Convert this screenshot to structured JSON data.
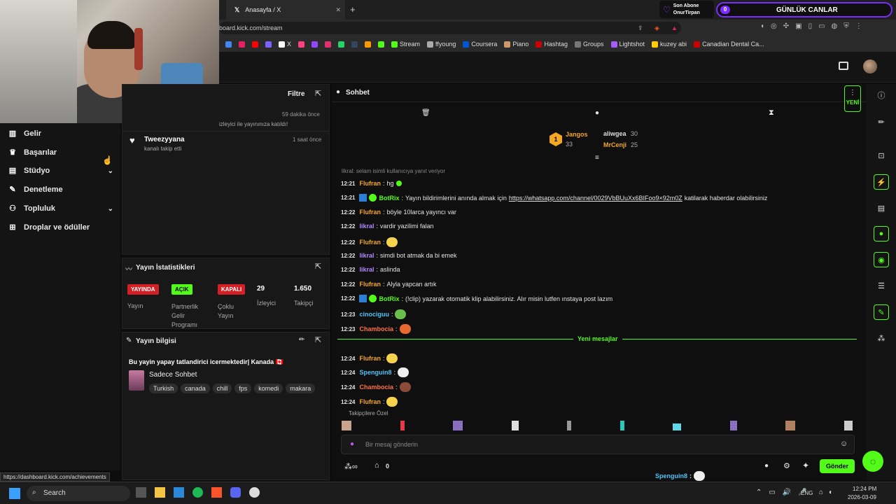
{
  "browser": {
    "tab_title": "Anasayfa / X",
    "new_tab": "+",
    "url": "board.kick.com/stream",
    "status_url": "https://dashboard.kick.com/achievements",
    "bookmarks": [
      {
        "label": "",
        "color": "#4285f4"
      },
      {
        "label": "",
        "color": "#e91e63"
      },
      {
        "label": "",
        "color": "#ff0000"
      },
      {
        "label": "",
        "color": "#7b61ff"
      },
      {
        "label": "X",
        "color": "#ffffff"
      },
      {
        "label": "",
        "color": "#ff4081"
      },
      {
        "label": "",
        "color": "#9146ff"
      },
      {
        "label": "",
        "color": "#e1306c"
      },
      {
        "label": "",
        "color": "#25d366"
      },
      {
        "label": "",
        "color": "#35465c"
      },
      {
        "label": "",
        "color": "#ff9900"
      },
      {
        "label": "",
        "color": "#53fc18"
      },
      {
        "label": "Stream",
        "color": "#53fc18"
      },
      {
        "label": "ffyoung",
        "color": "#aaaaaa"
      },
      {
        "label": "Coursera",
        "color": "#0056d2"
      },
      {
        "label": "Piano",
        "color": "#cc9966"
      },
      {
        "label": "Hashtag",
        "color": "#cc0000"
      },
      {
        "label": "Groups",
        "color": "#777777"
      },
      {
        "label": "Lightshot",
        "color": "#a45cff"
      },
      {
        "label": "kuzey abi",
        "color": "#ffcc00"
      },
      {
        "label": "Canadian Dental Ca...",
        "color": "#cc0000"
      }
    ]
  },
  "widgets": {
    "son_abone_title": "Son Abone",
    "son_abone_name": "OnurTirpan",
    "counter_value": "0",
    "counter_title": "GÜNLÜK CANLAR"
  },
  "sidebar": {
    "items": [
      {
        "label": "Gelir",
        "icon": "chart-icon"
      },
      {
        "label": "Başarılar",
        "icon": "trophy-icon"
      },
      {
        "label": "Stüdyo",
        "icon": "studio-icon"
      },
      {
        "label": "Denetleme",
        "icon": "wrench-icon"
      },
      {
        "label": "Topluluk",
        "icon": "people-icon"
      },
      {
        "label": "Droplar ve ödüller",
        "icon": "gift-icon"
      }
    ]
  },
  "activity": {
    "filter": "Filtre",
    "time1": "59 dakika önce",
    "line1": "izleyici ile yayınınıza katıldı!",
    "name2": "Tweezyyana",
    "sub2": "kanalı takip etti",
    "time2": "1 saat önce"
  },
  "stats": {
    "title": "Yayın İstatistikleri",
    "badge_live": "YAYINDA",
    "label_live": "Yayın",
    "badge_open": "AÇIK",
    "label_open": "Partnerlik Gelir Programı",
    "badge_closed": "KAPALI",
    "label_closed": "Çoklu Yayın",
    "viewers": "29",
    "viewers_label": "İzleyici",
    "followers": "1.650",
    "followers_label": "Takipçi"
  },
  "stream_info": {
    "title": "Yayın bilgisi",
    "stream_title": "Bu yayin yapay tatlandirici icermektedir| Kanada 🇨🇦",
    "category": "Sadece Sohbet",
    "tags": [
      "Turkish",
      "canada",
      "chill",
      "fps",
      "komedi",
      "makara"
    ]
  },
  "chat": {
    "title": "Sohbet",
    "top1_name": "Jangos",
    "top1_count": "33",
    "top2_name": "aliwgea",
    "top2_count": "30",
    "top3_name": "MrCenji",
    "top3_count": "25",
    "reply_hint": "likral: selam isimli kullanıcıya yanıt veriyor",
    "messages": [
      {
        "time": "12:21",
        "user": "Flufran",
        "color": "#f5a623",
        "text": "hg",
        "emote": "heart"
      },
      {
        "time": "12:21",
        "user": "BotRix",
        "color": "#53fc18",
        "text": "Yayın bildirimlerini anında almak için ",
        "link": "https://whatsapp.com/channel/0029VbBUuXx6BIFoo9×92m0Z",
        "after": " katilarak haberdar olabilirsiniz"
      },
      {
        "time": "12:22",
        "user": "Flufran",
        "color": "#f5a623",
        "text": "böyle 10larca yayıncı var"
      },
      {
        "time": "12:22",
        "user": "likral",
        "color": "#b388ff",
        "text": "vardir yazilimi falan"
      },
      {
        "time": "12:22",
        "user": "Flufran",
        "color": "#f5a623",
        "text": "",
        "emote": "face"
      },
      {
        "time": "12:22",
        "user": "likral",
        "color": "#b388ff",
        "text": "simdi bot atmak da bi emek"
      },
      {
        "time": "12:22",
        "user": "likral",
        "color": "#b388ff",
        "text": "aslinda"
      },
      {
        "time": "12:22",
        "user": "Flufran",
        "color": "#f5a623",
        "text": "Alyla yapcan artık"
      },
      {
        "time": "12:22",
        "user": "BotRix",
        "color": "#53fc18",
        "text": "(!clip) yazarak otomatik klip alabilirsiniz. Alır misin lutfen ınstaya post lazım"
      },
      {
        "time": "12:23",
        "user": "cinociguu",
        "color": "#4fc3f7",
        "text": "",
        "emote": "frog"
      },
      {
        "time": "12:23",
        "user": "Chambocia",
        "color": "#ff7043",
        "text": "",
        "emote": "cat"
      }
    ],
    "new_messages": "Yeni mesajlar",
    "new": [
      {
        "time": "12:24",
        "user": "Flufran",
        "color": "#f5a623",
        "emote": "face"
      },
      {
        "time": "12:24",
        "user": "Spenguin8",
        "color": "#4fc3f7",
        "emote": "skull"
      },
      {
        "time": "12:24",
        "user": "Chambocia",
        "color": "#ff7043",
        "emote": "photo"
      },
      {
        "time": "12:24",
        "user": "Flufran",
        "color": "#f5a623",
        "emote": "face"
      }
    ],
    "followers_only": "Takipçilere Özel",
    "input_placeholder": "Bir mesaj gönderin",
    "points": "0",
    "send": "Gönder",
    "new_badge": "YENİ"
  },
  "overlay": [
    {
      "user": "Spenguin8",
      "color": "#4fc3f7"
    },
    {
      "user": "Chambocia",
      "color": "#ff7043"
    },
    {
      "user": "Flufran",
      "color": "#f5a623"
    }
  ],
  "taskbar": {
    "search": "Search",
    "lang": "ENG",
    "time": "12:24 PM",
    "date": "2026-03-09"
  }
}
